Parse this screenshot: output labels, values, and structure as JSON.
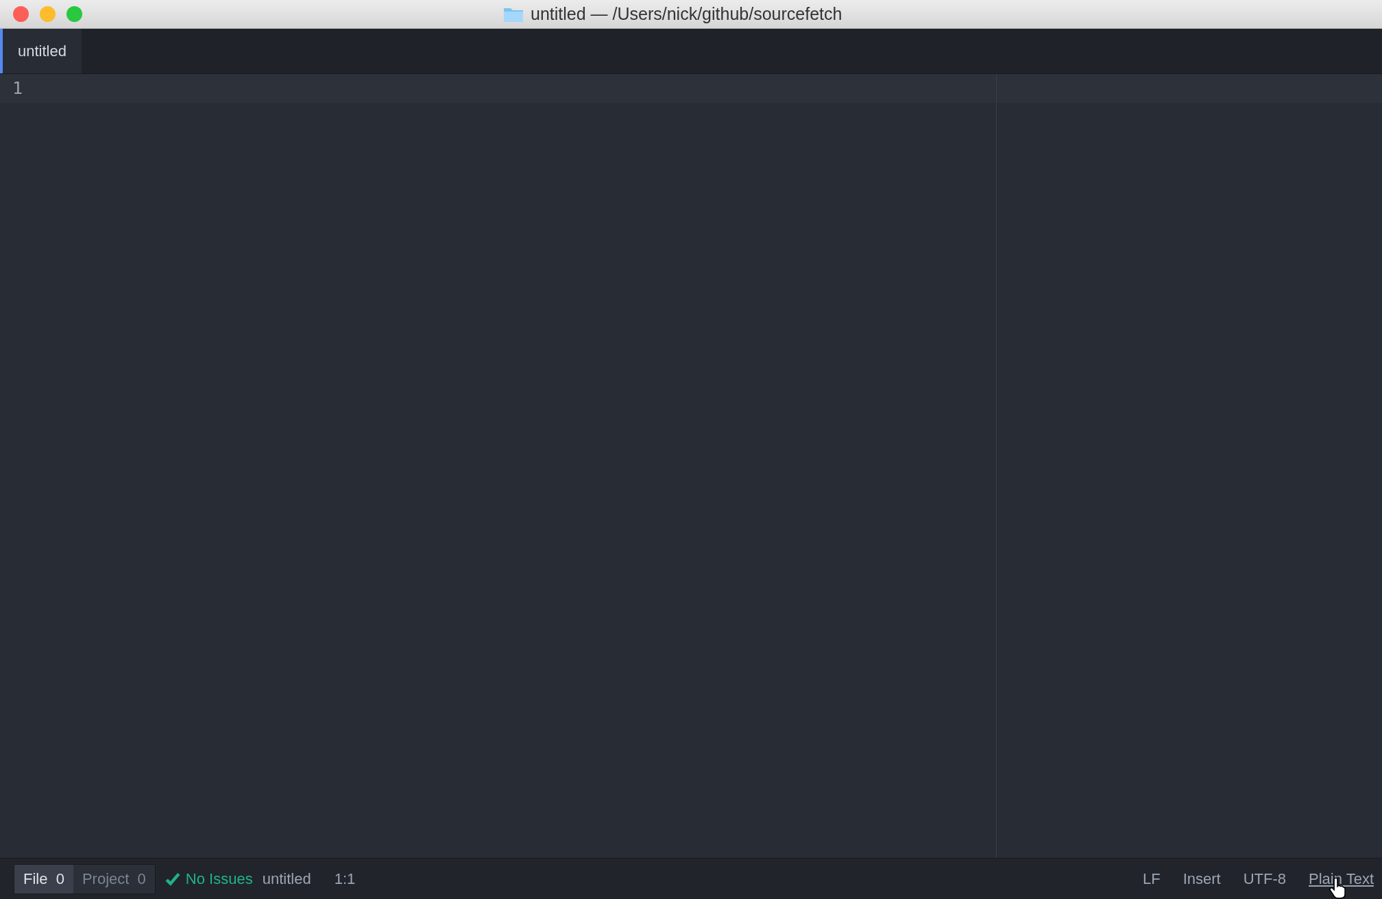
{
  "window": {
    "title": "untitled — /Users/nick/github/sourcefetch"
  },
  "tabs": [
    {
      "label": "untitled",
      "selected": true
    }
  ],
  "editor": {
    "line_numbers": [
      "1"
    ]
  },
  "status_bar": {
    "linter_tabs": [
      {
        "label": "File",
        "count": "0",
        "selected": true
      },
      {
        "label": "Project",
        "count": "0",
        "selected": false
      }
    ],
    "issues": "No Issues",
    "file_name": "untitled",
    "cursor_position": "1:1",
    "right_items": [
      "LF",
      "Insert",
      "UTF-8",
      "Plain Text"
    ]
  }
}
